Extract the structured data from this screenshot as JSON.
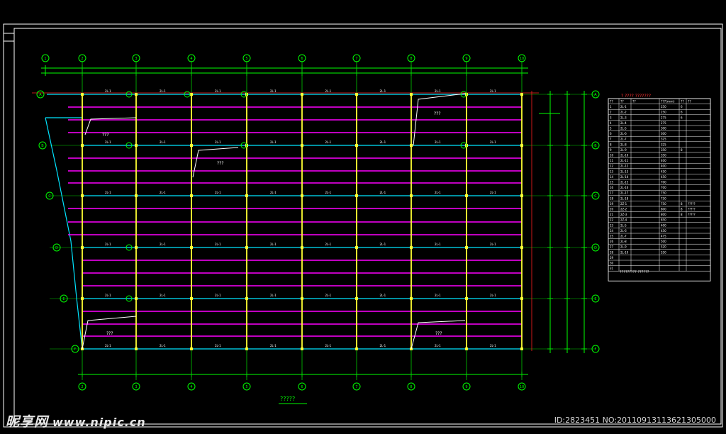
{
  "drawing": {
    "caption": "?????",
    "colors": {
      "grid_green": "#00cc00",
      "dim_green": "#00ff00",
      "beam_cyan": "#00e5ff",
      "beam_magenta": "#ff00ff",
      "column_yellow": "#ffff33",
      "red_line": "#ff2020",
      "frame_white": "#ffffff",
      "text_white": "#ffffff"
    },
    "col_axes": [
      "1",
      "2",
      "3",
      "4",
      "5",
      "6",
      "7",
      "8",
      "9",
      "10"
    ],
    "row_axes": [
      "A",
      "B",
      "C",
      "D",
      "E",
      "F"
    ],
    "opening_label": "???"
  },
  "table": {
    "title": "? ???? ???????",
    "headers": [
      "??",
      "??",
      "??",
      "???(mm)",
      "??",
      "??"
    ],
    "rows": [
      [
        "1",
        "2L-1",
        "",
        "250",
        "6",
        ""
      ],
      [
        "2",
        "2L-2",
        "",
        "250",
        "6",
        ""
      ],
      [
        "3",
        "2L-3",
        "",
        "275",
        "6",
        ""
      ],
      [
        "4",
        "2L-4",
        "",
        "275",
        "",
        ""
      ],
      [
        "5",
        "2L-5",
        "",
        "300",
        "",
        ""
      ],
      [
        "6",
        "2L-6",
        "",
        "300",
        "",
        ""
      ],
      [
        "7",
        "2L-7",
        "",
        "325",
        "",
        ""
      ],
      [
        "8",
        "2L-8",
        "",
        "325",
        "",
        ""
      ],
      [
        "9",
        "2L-9",
        "",
        "350",
        "8",
        ""
      ],
      [
        "10",
        "2L-10",
        "",
        "350",
        "",
        ""
      ],
      [
        "11",
        "2L-11",
        "",
        "400",
        "",
        ""
      ],
      [
        "12",
        "2L-12",
        "",
        "400",
        "",
        ""
      ],
      [
        "13",
        "2L-13",
        "",
        "450",
        "",
        ""
      ],
      [
        "14",
        "2L-14",
        "",
        "450",
        "",
        ""
      ],
      [
        "15",
        "2L-15",
        "",
        "700",
        "",
        ""
      ],
      [
        "16",
        "2L-16",
        "",
        "700",
        "",
        ""
      ],
      [
        "17",
        "2L-17",
        "",
        "750",
        "",
        ""
      ],
      [
        "18",
        "2L-18",
        "",
        "750",
        "",
        ""
      ],
      [
        "19",
        "2Z-1",
        "",
        "750",
        "8",
        "?????"
      ],
      [
        "20",
        "2Z-2",
        "",
        "800",
        "8",
        "?????"
      ],
      [
        "21",
        "2Z-3",
        "",
        "800",
        "8",
        "?????"
      ],
      [
        "22",
        "2Z-4",
        "",
        "850",
        "",
        ""
      ],
      [
        "23",
        "2L-5",
        "",
        "400",
        "",
        ""
      ],
      [
        "24",
        "2L-6",
        "",
        "450",
        "",
        ""
      ],
      [
        "25",
        "2L-7",
        "",
        "475",
        "",
        ""
      ],
      [
        "26",
        "2L-8",
        "",
        "500",
        "",
        ""
      ],
      [
        "27",
        "2L-9",
        "",
        "520",
        "",
        ""
      ],
      [
        "28",
        "2L-10",
        "",
        "550",
        "",
        ""
      ],
      [
        "29",
        "",
        "",
        "",
        "",
        ""
      ],
      [
        "30",
        "",
        "",
        "",
        "",
        ""
      ],
      [
        "31",
        "",
        "",
        "",
        "",
        ""
      ]
    ],
    "footer": "?????????  ??????"
  },
  "watermark": {
    "logo": "昵享网",
    "url": "www.nipic.cn",
    "id_text": "ID:2823451 NO:20110913113621305000"
  }
}
